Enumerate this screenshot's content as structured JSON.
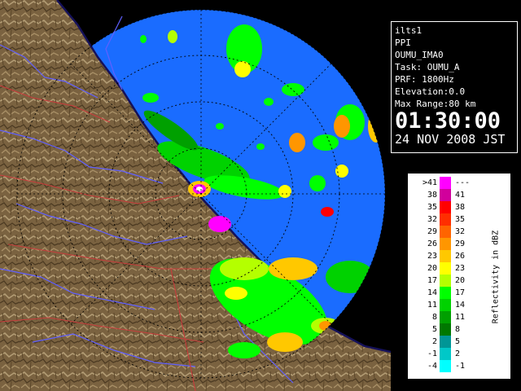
{
  "info": {
    "host": "ilts1",
    "product": "PPI",
    "site": "OUMU_IMA0",
    "task_line": "Task: OUMU_A",
    "prf_line": "PRF: 1800Hz",
    "elevation_line": "Elevation:0.0",
    "range_line": "Max Range:80 km",
    "time": "01:30:00",
    "date": "24 NOV 2008 JST"
  },
  "legend": {
    "title": "Reflectivity in dBZ",
    "rows": [
      {
        "low": ">41",
        "high": "---",
        "color": "#ff00ff"
      },
      {
        "low": "38",
        "high": "41",
        "color": "#d1009c"
      },
      {
        "low": "35",
        "high": "38",
        "color": "#ff0000"
      },
      {
        "low": "32",
        "high": "35",
        "color": "#ff2e00"
      },
      {
        "low": "29",
        "high": "32",
        "color": "#ff6400"
      },
      {
        "low": "26",
        "high": "29",
        "color": "#ff9600"
      },
      {
        "low": "23",
        "high": "26",
        "color": "#ffc800"
      },
      {
        "low": "20",
        "high": "23",
        "color": "#ffff00"
      },
      {
        "low": "17",
        "high": "20",
        "color": "#b4ff00"
      },
      {
        "low": "14",
        "high": "17",
        "color": "#00ff00"
      },
      {
        "low": "11",
        "high": "14",
        "color": "#00d200"
      },
      {
        "low": "8",
        "high": "11",
        "color": "#00a000"
      },
      {
        "low": "5",
        "high": "8",
        "color": "#007800"
      },
      {
        "low": "2",
        "high": "5",
        "color": "#009696"
      },
      {
        "low": "-1",
        "high": "2",
        "color": "#00c8c8"
      },
      {
        "low": "-4",
        "high": "-1",
        "color": "#00ffff"
      }
    ]
  },
  "map_colors": {
    "radar_fill": "#1a6cff",
    "land": "#7a6240",
    "land_light": "#b29c74",
    "coast": "#15115a",
    "river": "#6060ff",
    "border": "#c83c3c",
    "range_ring": "#000000"
  }
}
